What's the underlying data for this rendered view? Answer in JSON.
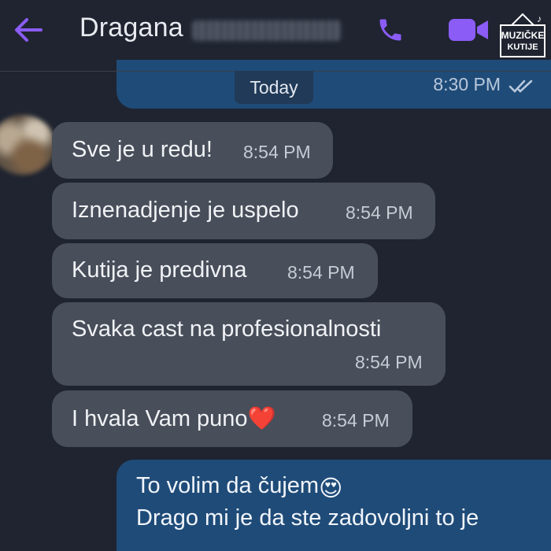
{
  "header": {
    "contact_name": "Dragana",
    "back_icon": "arrow-left-icon",
    "call_icon": "phone-icon",
    "video_icon": "video-camera-icon",
    "accent_color": "#8b5cf6"
  },
  "watermark": {
    "line1": "MUZIČKE",
    "line2": "KUTIJE"
  },
  "date_chip": "Today",
  "top_message": {
    "time": "8:30 PM",
    "status_icon": "double-check-icon"
  },
  "incoming": [
    {
      "text": "Sve je u redu!",
      "time": "8:54 PM"
    },
    {
      "text": "Iznenadjenje je uspelo",
      "time": "8:54 PM"
    },
    {
      "text": "Kutija je predivna",
      "time": "8:54 PM"
    },
    {
      "text": "Svaka cast na profesionalnosti",
      "time": "8:54 PM"
    },
    {
      "text": "I hvala Vam puno",
      "time": "8:54 PM",
      "emoji": "❤️"
    }
  ],
  "outgoing": {
    "line1": "To volim da čujem",
    "line1_emoji": "😍",
    "line2": "Drago mi je da ste zadovoljni to je"
  },
  "colors": {
    "background": "#1f2430",
    "incoming_bubble": "#484e5a",
    "outgoing_bubble": "#1f4b78"
  }
}
